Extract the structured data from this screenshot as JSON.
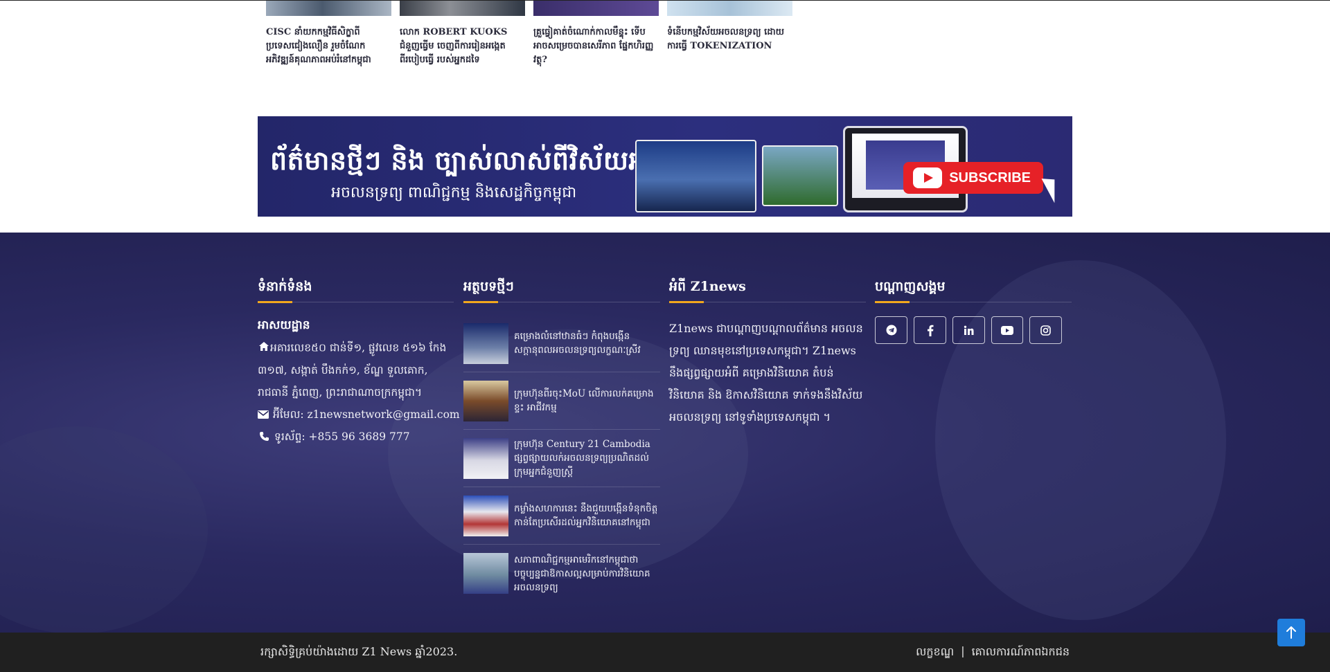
{
  "related": [
    {
      "title": "CISC នាំយកកម្មវិធីសិក្ខាពី ប្រទេសជៀងលឿន រួមចំណែក អភិវឌ្ឍន៍គុណភាពអប់រំនៅកម្ពុជា",
      "thumb_color": "#6b7a8e"
    },
    {
      "title": "លោក ROBERT KUOKS ជំនួញធ្វើម ចេញពីការរៀនអង្កេតពីរបៀបធ្វើ របស់អ្នកដទៃ",
      "thumb_color": "#5b5f66"
    },
    {
      "title": "គ្រួធ្វៀគាត់ចំណោក់កាលមឹន្ទុះ ទើប អាចសម្រេចបានសេរីភាព ផ្នែកហិរញ្ញវត្ថុ?",
      "thumb_color": "#4a3c80"
    },
    {
      "title": "ទំនើបកម្មវិស័យអចលនទ្រព្យ ដោយការធ្វើ TOKENIZATION",
      "thumb_color": "#b9d0e2"
    }
  ],
  "banner": {
    "headline": "ព័ត៌មានថ្មីៗ និង ច្បាស់លាស់ពីវិស័យអចលនទ្រព្យ",
    "subline": "អចលនទ្រព្យ ពាណិជ្ជកម្ម និងសេដ្ឋកិច្ចកម្ពុជា",
    "subscribe_label": "SUBSCRIBE",
    "bg_color": "#2a2c78"
  },
  "contact": {
    "title": "ទំនាក់ទំនង",
    "address_label": "អាសយដ្ឋាន",
    "address": "អគារលេខ៥០ ជាន់ទី១, ផ្លូវលេខ ៥១៦ កែង ៣១៧, សង្កាត់ បឹងកក់១, ខ័ណ្ឌ ទួលគោក, រាជធានី ភ្នំពេញ, ព្រះរាជាណាចក្រកម្ពុជា។",
    "email": "អ៊ីមែល: z1newsnetwork@gmail.com",
    "phone": "ទូរស័ព្ទ: +855 96 3689 777"
  },
  "news": {
    "title": "អត្ថបទថ្មីៗ",
    "items": [
      {
        "text": "គម្រោងលំនៅឋានធំៗ កំពុងបង្កើន សក្ដានុពលអចលនទ្រព្យលក្ខណៈស្រីវ"
      },
      {
        "text": "ក្រុមហ៊ុនពីរចុះMoU លើការលក់គម្រោងខ្ទះ អាជីវកម្ម"
      },
      {
        "text": "ក្រុមហ៊ុន Century 21 Cambodia ផ្សព្វផ្សាយលក់អចលនទ្រព្យប្រណិតដល់ ក្រុមអ្នកជំនួញស្ត្រី"
      },
      {
        "text": "កម្លាំងសហការនេះ នឹងជួយបង្កើនទំនុកចិត្ត កាន់តែប្រសើរដល់អ្នកវិនិយោគនៅកម្ពុជា"
      },
      {
        "text": "សភាពាណិជ្ជកម្មអាមេរិកនៅកម្ពុជាថា បច្ចុប្បន្នជាឱកាសល្អសម្រាប់ការវិនិយោគ អចលនទ្រព្យ"
      }
    ]
  },
  "about": {
    "title": "អំពី Z1news",
    "text": "Z1news ជាបណ្ដាញបណ្ដាលព័ត៌មាន អចលនទ្រព្យ ឈានមុខនៅប្រទេសកម្ពុជា។ Z1news នឹងផ្សព្វផ្សាយអំពី គម្រោងវិនិយោគ តំបន់វិនិយោគ និង ឱកាសវិនិយោគ ទាក់ទងនឹងវិស័យអចលនទ្រព្យ នៅទូទាំងប្រទេសកម្ពុជា ។"
  },
  "social": {
    "title": "បណ្ដាញសង្គម",
    "items": [
      {
        "icon": "telegram-icon"
      },
      {
        "icon": "facebook-icon"
      },
      {
        "icon": "linkedin-icon"
      },
      {
        "icon": "youtube-icon"
      },
      {
        "icon": "instagram-icon"
      }
    ]
  },
  "bottom": {
    "copyright": "រក្សាសិទ្ធិគ្រប់យ៉ាងដោយ Z1 News ឆ្នាំ2023.",
    "terms_label": "លក្ខខណ្ឌ",
    "separator": "|",
    "privacy_label": "គោលការណ៍ភាពឯកជន"
  },
  "colors": {
    "accent": "#f2a81d",
    "footer_bg": "#2a2960",
    "back_top": "#1f7ddb",
    "bottom_bar": "#202020"
  }
}
